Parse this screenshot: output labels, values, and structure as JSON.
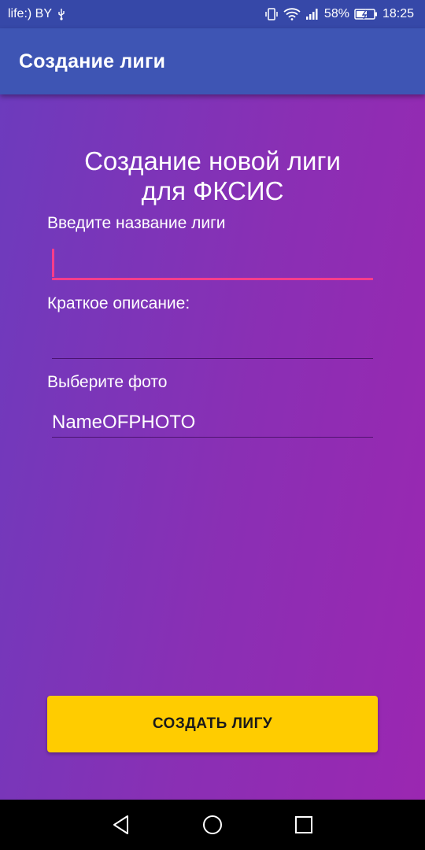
{
  "status_bar": {
    "carrier": "life:) BY",
    "battery": "58%",
    "time": "18:25",
    "icons": [
      "usb-icon",
      "vibrate-icon",
      "wifi-icon",
      "signal-icon",
      "battery-charging-icon"
    ]
  },
  "app_bar": {
    "title": "Создание лиги"
  },
  "form": {
    "heading_line1": "Создание новой лиги",
    "heading_line2": "для ФКСИС",
    "name_label": "Введите название лиги",
    "name_value": "",
    "description_label": "Краткое описание:",
    "description_value": "",
    "photo_label": "Выберите фото",
    "photo_value": "NameOFPHOTO"
  },
  "button": {
    "label": "СОЗДАТЬ ЛИГУ"
  },
  "nav_bar": {
    "icons": [
      "back-icon",
      "home-icon",
      "recents-icon"
    ]
  },
  "colors": {
    "status_bar": "#3648a8",
    "app_bar": "#3e55b4",
    "gradient_start": "#6d3bbd",
    "gradient_end": "#9b27b1",
    "accent": "#ff3d8a",
    "button": "#ffcc00"
  }
}
